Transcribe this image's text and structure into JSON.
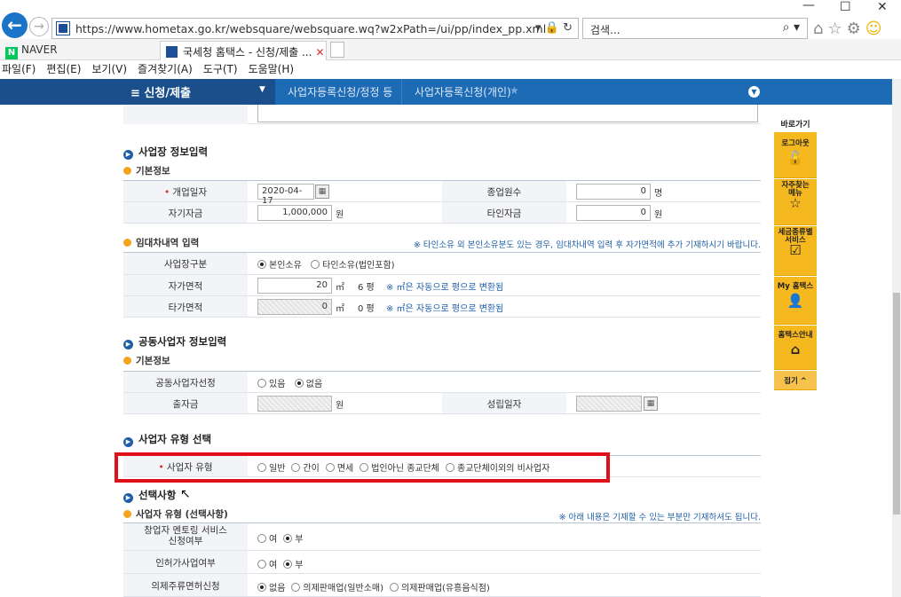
{
  "browser": {
    "url": "https://www.hometax.go.kr/websquare/websquare.wq?w2xPath=/ui/pp/index_pp.xml",
    "search_placeholder": "검색...",
    "tabs": [
      {
        "label": "NAVER"
      },
      {
        "label": "국세청 홈택스 - 신청/제출 ..."
      }
    ],
    "menu": [
      "파일(F)",
      "편집(E)",
      "보기(V)",
      "즐겨찾기(A)",
      "도구(T)",
      "도움말(H)"
    ],
    "win_min": "—",
    "win_max": "☐",
    "win_close": "✕"
  },
  "nav": {
    "menu_label": "≡ 신청/제출",
    "crumb1": "사업자등록신청/정정 등",
    "crumb2": "사업자등록신청(개인)"
  },
  "biz_place": {
    "title": "사업장 정보입력",
    "basic_title": "기본정보",
    "open_date_label": "개업일자",
    "open_date": "2020-04-17",
    "employees_label": "종업원수",
    "employees": "0",
    "employees_unit": "명",
    "own_capital_label": "자기자금",
    "own_capital": "1,000,000",
    "own_capital_unit": "원",
    "other_capital_label": "타인자금",
    "other_capital": "0",
    "other_capital_unit": "원"
  },
  "lease": {
    "title": "임대차내역 입력",
    "note": "※ 타인소유 외 본인소유분도 있는 경우, 임대차내역 입력 후 자가면적에 추가 기재하시기 바랍니다.",
    "type_label": "사업장구분",
    "opt_own": "본인소유",
    "opt_other": "타인소유(법인포함)",
    "own_area_label": "자가면적",
    "own_area": "20",
    "area_unit": "㎡",
    "own_pyeong": "6 평",
    "area_note": "※ ㎡은 자동으로 평으로 변환됨",
    "other_area_label": "타가면적",
    "other_area": "0",
    "other_pyeong": "0 평",
    "area_note2": "※ ㎡은 자동으로 평으로 변환됨"
  },
  "joint": {
    "title": "공동사업자 정보입력",
    "basic_title": "기본정보",
    "select_label": "공동사업자선정",
    "opt_yes": "있음",
    "opt_no": "없음",
    "invest_label": "출자금",
    "invest_unit": "원",
    "est_date_label": "성립일자"
  },
  "biz_type": {
    "title": "사업자 유형 선택",
    "label": "사업자 유형",
    "opts": [
      "일반",
      "간이",
      "면세",
      "법인아닌 종교단체",
      "종교단체이외의 비사업자"
    ]
  },
  "options": {
    "title": "선택사항",
    "sub_title": "사업자 유형 (선택사항)",
    "note": "※ 아래 내용은 기재할 수 있는 부분만 기재하셔도 됩니다.",
    "mentor_label_1": "창업자 멘토링 서비스",
    "mentor_label_2": "신청여부",
    "yes": "여",
    "no": "부",
    "permit_label": "인허가사업여부",
    "liquor_label": "의제주류면허신청",
    "liquor_none": "없음",
    "liquor_opt1": "의제판매업(일반소매)",
    "liquor_opt2": "의제판매업(유흥음식점)"
  },
  "quick": {
    "title": "바로가기",
    "items": [
      "로그아웃",
      "자주찾는 메뉴",
      "세금종류별 서비스",
      "My 홈택스",
      "홈택스안내"
    ],
    "fold": "접기 ^"
  }
}
